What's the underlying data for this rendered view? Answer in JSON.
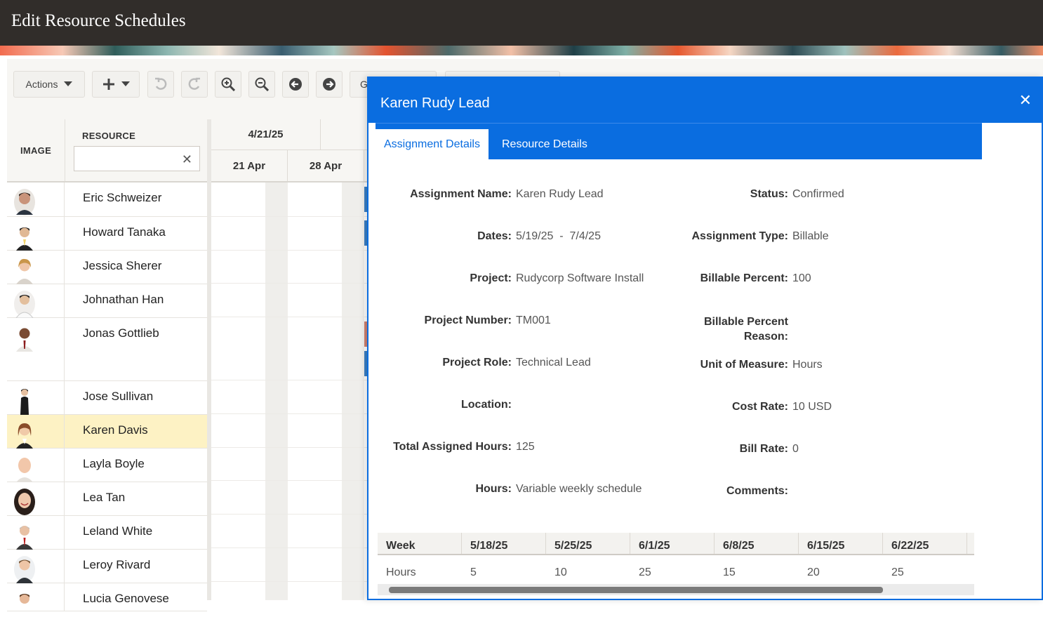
{
  "page_title": "Edit Resource Schedules",
  "toolbar": {
    "actions_label": "Actions",
    "partial_button_1": "G"
  },
  "grid": {
    "image_header": "IMAGE",
    "resource_header": "RESOURCE",
    "filter_placeholder": "",
    "rows": [
      {
        "name": "Eric Schweizer"
      },
      {
        "name": "Howard Tanaka"
      },
      {
        "name": "Jessica Sherer"
      },
      {
        "name": "Johnathan Han"
      },
      {
        "name": "Jonas Gottlieb"
      },
      {
        "name": "Jose Sullivan"
      },
      {
        "name": "Karen Davis"
      },
      {
        "name": "Layla Boyle"
      },
      {
        "name": "Lea Tan"
      },
      {
        "name": "Leland White"
      },
      {
        "name": "Leroy Rivard"
      },
      {
        "name": "Lucia Genovese"
      }
    ]
  },
  "timeline": {
    "week_label": "4/21/25",
    "days": [
      "21 Apr",
      "28 Apr"
    ]
  },
  "dialog": {
    "title": "Karen Rudy Lead",
    "tabs": [
      "Assignment Details",
      "Resource Details"
    ],
    "fields_left": [
      {
        "label": "Assignment Name:",
        "value": "Karen Rudy Lead"
      },
      {
        "label": "Dates:",
        "value": "5/19/25  -  7/4/25"
      },
      {
        "label": "Project:",
        "value": "Rudycorp Software Install"
      },
      {
        "label": "Project Number:",
        "value": "TM001"
      },
      {
        "label": "Project Role:",
        "value": "Technical Lead"
      },
      {
        "label": "Location:",
        "value": ""
      },
      {
        "label": "Total Assigned Hours:",
        "value": "125"
      },
      {
        "label": "Hours:",
        "value": "Variable weekly schedule"
      }
    ],
    "fields_right": [
      {
        "label": "Status:",
        "value": "Confirmed"
      },
      {
        "label": "Assignment Type:",
        "value": "Billable"
      },
      {
        "label": "Billable Percent:",
        "value": "100"
      },
      {
        "label": "Billable Percent Reason:",
        "value": ""
      },
      {
        "label": "Unit of Measure:",
        "value": "Hours"
      },
      {
        "label": "Cost Rate:",
        "value": "10 USD"
      },
      {
        "label": "Bill Rate:",
        "value": "0"
      },
      {
        "label": "Comments:",
        "value": ""
      }
    ],
    "week_table": {
      "headers": [
        "Week",
        "5/18/25",
        "5/25/25",
        "6/1/25",
        "6/8/25",
        "6/15/25",
        "6/22/25"
      ],
      "row": [
        "Hours",
        "5",
        "10",
        "25",
        "15",
        "20",
        "25"
      ]
    }
  },
  "colors": {
    "accent": "#0a6de0",
    "titlebar": "#312d2a",
    "selected_row": "#fdf2c4",
    "bar_blue": "#3b7fc4",
    "bar_red": "#d08070"
  }
}
